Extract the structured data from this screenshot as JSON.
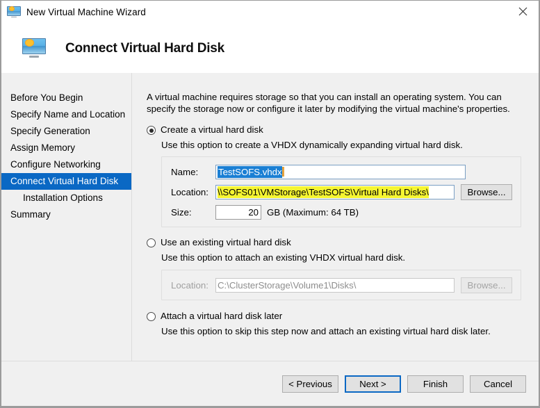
{
  "window": {
    "title": "New Virtual Machine Wizard",
    "title_icon": "virtual-machine-icon",
    "close_icon": "close-icon"
  },
  "header": {
    "title": "Connect Virtual Hard Disk",
    "icon": "virtual-machine-icon"
  },
  "sidebar": {
    "items": [
      {
        "label": "Before You Begin",
        "selected": false,
        "indent": false
      },
      {
        "label": "Specify Name and Location",
        "selected": false,
        "indent": false
      },
      {
        "label": "Specify Generation",
        "selected": false,
        "indent": false
      },
      {
        "label": "Assign Memory",
        "selected": false,
        "indent": false
      },
      {
        "label": "Configure Networking",
        "selected": false,
        "indent": false
      },
      {
        "label": "Connect Virtual Hard Disk",
        "selected": true,
        "indent": false
      },
      {
        "label": "Installation Options",
        "selected": false,
        "indent": true
      },
      {
        "label": "Summary",
        "selected": false,
        "indent": false
      }
    ]
  },
  "main": {
    "intro": "A virtual machine requires storage so that you can install an operating system. You can specify the storage now or configure it later by modifying the virtual machine's properties.",
    "option_create": {
      "label": "Create a virtual hard disk",
      "selected": true,
      "description": "Use this option to create a VHDX dynamically expanding virtual hard disk.",
      "name_label": "Name:",
      "name_value": "TestSOFS.vhdx",
      "location_label": "Location:",
      "location_value": "\\\\SOFS01\\VMStorage\\TestSOFS\\Virtual Hard Disks\\",
      "browse_label": "Browse...",
      "size_label": "Size:",
      "size_value": "20",
      "size_suffix": "GB (Maximum: 64 TB)"
    },
    "option_existing": {
      "label": "Use an existing virtual hard disk",
      "selected": false,
      "description": "Use this option to attach an existing VHDX virtual hard disk.",
      "location_label": "Location:",
      "location_value": "C:\\ClusterStorage\\Volume1\\Disks\\",
      "browse_label": "Browse..."
    },
    "option_later": {
      "label": "Attach a virtual hard disk later",
      "selected": false,
      "description": "Use this option to skip this step now and attach an existing virtual hard disk later."
    }
  },
  "footer": {
    "previous": "< Previous",
    "next": "Next >",
    "finish": "Finish",
    "cancel": "Cancel"
  },
  "colors": {
    "selection_blue": "#0a68c4",
    "text_selection_blue": "#1a7fd4",
    "highlight_yellow": "#f5f531",
    "caret_orange": "#e8a33d"
  }
}
